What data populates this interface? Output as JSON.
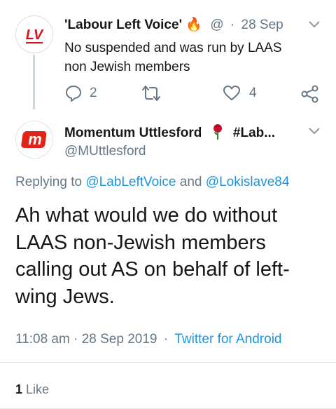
{
  "reply_tweet": {
    "display_name": "'Labour Left Voice'",
    "name_emoji": "🔥",
    "handle_fragment": "@",
    "separator": "·",
    "date": "28 Sep",
    "text_line1": "No suspended and was run by LAAS",
    "text_line2": "non Jewish members",
    "reply_count": "2",
    "like_count": "4",
    "avatar_text": "LV"
  },
  "main_tweet": {
    "display_name": "Momentum Uttlesford",
    "name_suffix": "#Lab...",
    "handle": "@MUttlesford",
    "avatar_text": "m",
    "replying_prefix": "Replying to",
    "reply_user1": "@LabLeftVoice",
    "reply_and": "and",
    "reply_user2": "@Lokislave84",
    "body_line1": "Ah what would we do without",
    "body_line2": "LAAS non-Jewish members",
    "body_line3": "calling out AS on behalf of left-",
    "body_line4": "wing Jews.",
    "time": "11:08 am",
    "sep1": "·",
    "date": "28 Sep 2019",
    "sep2": "·",
    "client": "Twitter for Android",
    "likes_count": "1",
    "likes_label": "Like"
  },
  "colors": {
    "accent_blue": "#1b95e0",
    "muted_gray": "#657786",
    "momentum_red": "#e2231a",
    "divider": "#e1e8ed"
  },
  "icons": [
    "reply-icon",
    "retweet-icon",
    "like-icon",
    "share-icon",
    "chevron-down-icon",
    "rose-icon"
  ]
}
